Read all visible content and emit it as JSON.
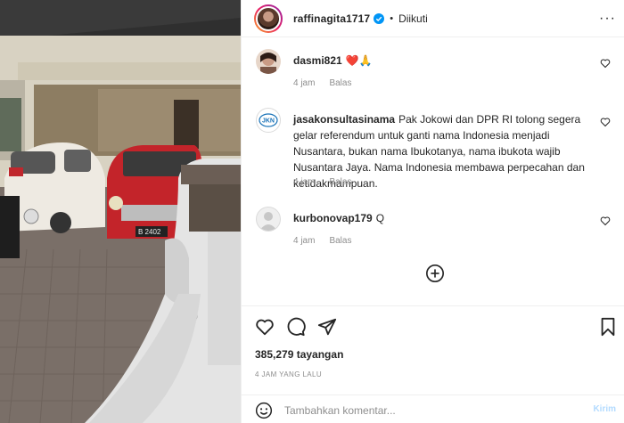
{
  "post": {
    "username": "raffinagita1717",
    "follow_status": "Diikuti",
    "verified": true
  },
  "comments": [
    {
      "username": "dasmi821",
      "text": "❤️🙏",
      "time": "4 jam",
      "reply_label": "Balas",
      "avatar": "photo-avatar"
    },
    {
      "username": "jasakonsultasinama",
      "text": "Pak Jokowi dan DPR RI tolong segera gelar referendum untuk ganti nama Indonesia menjadi Nusantara, bukan nama Ibukotanya, nama ibukota wajib Nusantara Jaya. Nama Indonesia membawa perpecahan dan ketidakmampuan.",
      "time": "4 jam",
      "reply_label": "Balas",
      "avatar": "jkn-logo",
      "avatar_text": "JKN"
    },
    {
      "username": "kurbonovap179",
      "text": "Q",
      "time": "4 jam",
      "reply_label": "Balas",
      "avatar": "default-avatar"
    }
  ],
  "actions": {
    "views": "385,279 tayangan",
    "posted_ago": "4 JAM YANG LALU"
  },
  "add_comment": {
    "placeholder": "Tambahkan komentar...",
    "post_label": "Kirim"
  },
  "icons": [
    "verified-badge-icon",
    "more-options-icon",
    "heart-icon",
    "comment-icon",
    "share-icon",
    "bookmark-icon",
    "emoji-icon",
    "load-more-icon"
  ],
  "colors": {
    "accent": "#0095f6",
    "muted": "#8e8e8e",
    "post_disabled": "#b3dbff"
  }
}
